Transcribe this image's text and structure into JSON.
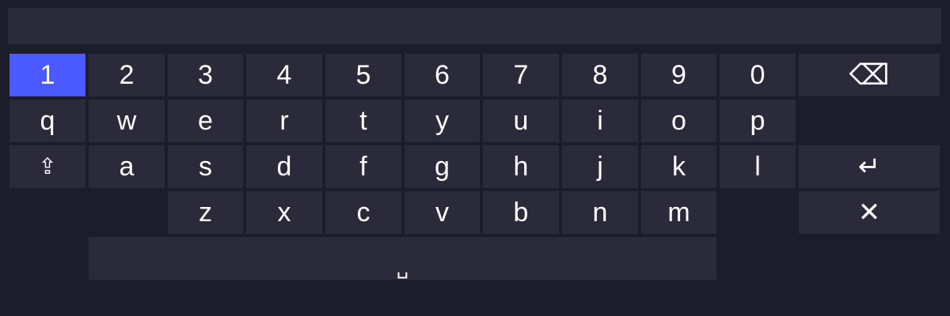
{
  "colors": {
    "background": "#1c1c2b",
    "key": "#2a2a3a",
    "focused_key": "#4a5aff",
    "text": "#ffffff"
  },
  "input": {
    "value": ""
  },
  "keyboard": {
    "focused_key": "1",
    "row_numbers": [
      "1",
      "2",
      "3",
      "4",
      "5",
      "6",
      "7",
      "8",
      "9",
      "0"
    ],
    "row_top": [
      "q",
      "w",
      "e",
      "r",
      "t",
      "y",
      "u",
      "i",
      "o",
      "p"
    ],
    "row_home": [
      "a",
      "s",
      "d",
      "f",
      "g",
      "h",
      "j",
      "k",
      "l"
    ],
    "row_bottom": [
      "z",
      "x",
      "c",
      "v",
      "b",
      "n",
      "m"
    ],
    "backspace": "⌫",
    "shift": "⇪",
    "enter": "↵",
    "close": "✕",
    "space": "␣",
    "icons": {
      "backspace": "backspace-icon",
      "shift": "shift-icon",
      "enter": "enter-icon",
      "close": "close-icon",
      "space": "space-icon"
    }
  }
}
